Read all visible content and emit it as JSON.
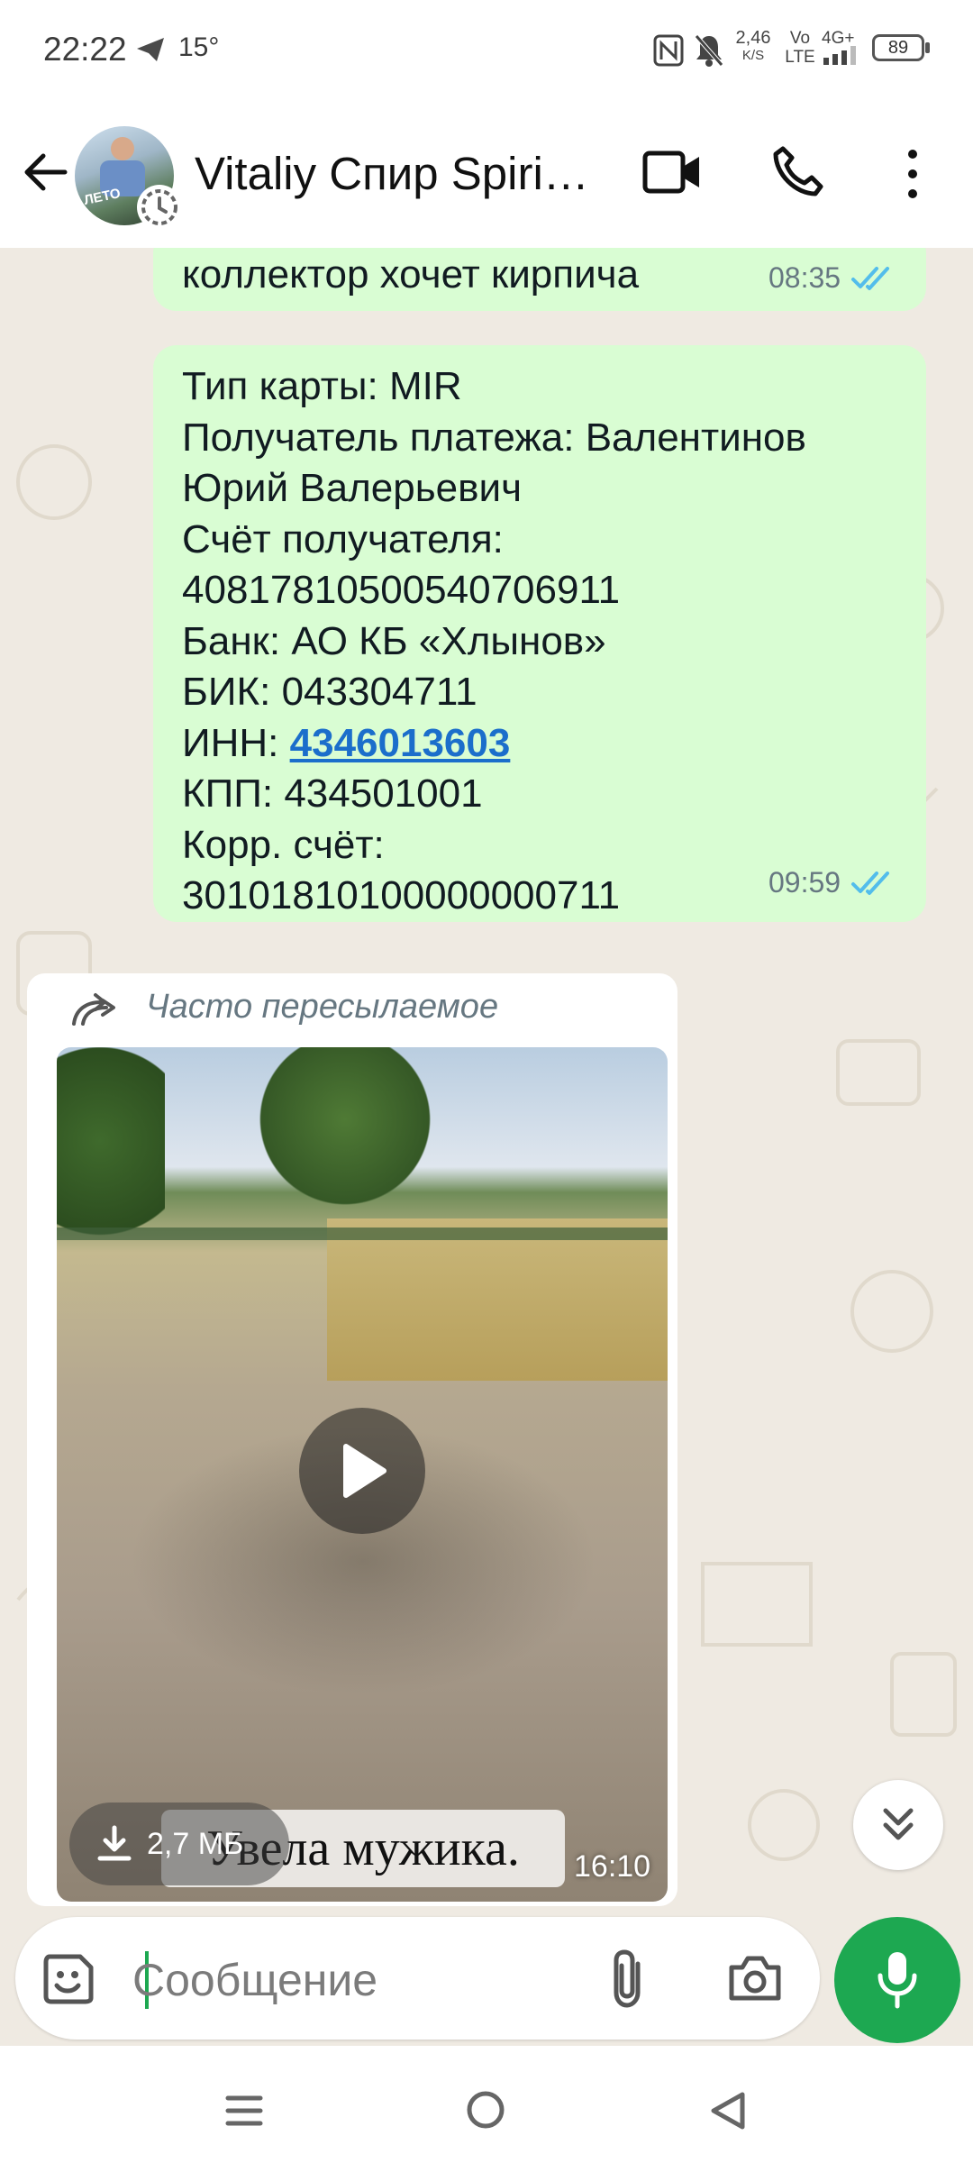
{
  "status_bar": {
    "time": "22:22",
    "temperature": "15°",
    "net_speed_value": "2,46",
    "net_speed_unit": "K/S",
    "volte_top": "Vo",
    "volte_bottom": "LTE",
    "network": "4G+",
    "battery": "89"
  },
  "header": {
    "contact_name": "Vitaliy Спир Spiridonov",
    "avatar_text": "ЛЕТО"
  },
  "messages": [
    {
      "text": "коллектор хочет кирпича",
      "time": "08:35"
    },
    {
      "lines_before_inn": "Тип карты: MIR\nПолучатель платежа: Валентинов\nЮрий Валерьевич\nСчёт получателя:\n40817810500540706911\nБанк: АО КБ «Хлынов»\nБИК: 043304711",
      "inn_label": "ИНН: ",
      "inn_value": "4346013603",
      "lines_after_inn": "КПП: 434501001\nКорр. счёт:\n30101810100000000711",
      "time": "09:59"
    }
  ],
  "forwarded_video": {
    "forwarded_label": "Часто пересылаемое",
    "file_size": "2,7 МБ",
    "subtitle": "Увела мужика.",
    "duration": "16:10"
  },
  "composer": {
    "placeholder": "Сообщение"
  },
  "colors": {
    "outgoing_bubble": "#d9fdd3",
    "chat_background": "#efeae2",
    "accent_green": "#1da851",
    "read_ticks": "#53bdeb",
    "link": "#1b6ecb"
  }
}
